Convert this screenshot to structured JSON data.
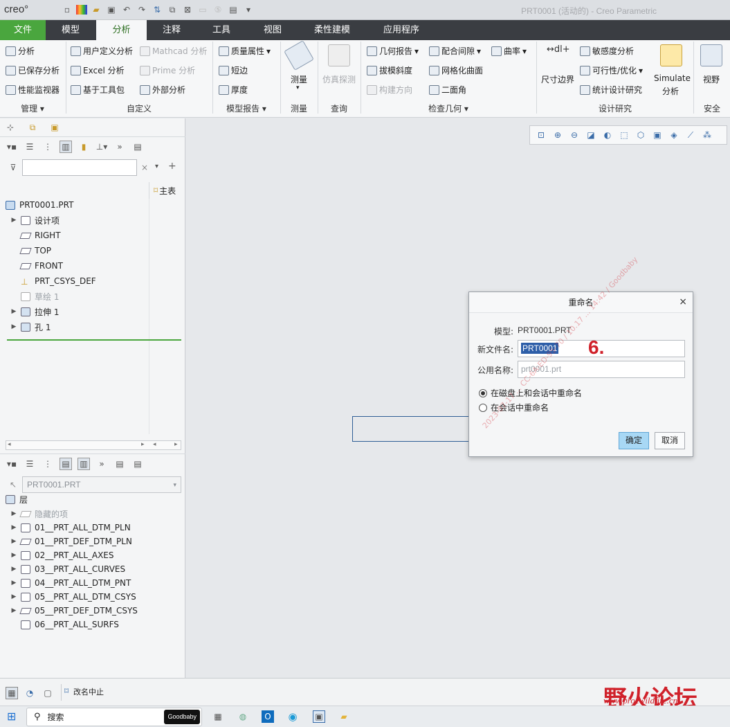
{
  "window": {
    "logo": "creo°",
    "title": "PRT0001 (活动的) - Creo Parametric"
  },
  "tabs": [
    "文件",
    "模型",
    "分析",
    "注释",
    "工具",
    "视图",
    "柔性建模",
    "应用程序"
  ],
  "ribbon": {
    "manage": {
      "items": [
        "分析",
        "已保存分析",
        "性能监视器"
      ],
      "group": "管理"
    },
    "custom": {
      "items": [
        "用户定义分析",
        "Excel 分析",
        "基于工具包",
        "Mathcad 分析",
        "Prime 分析",
        "外部分析"
      ],
      "group": "自定义"
    },
    "model_report": {
      "items": [
        "质量属性",
        "短边",
        "厚度"
      ],
      "group": "模型报告"
    },
    "measure": {
      "label": "测量",
      "group": "测量"
    },
    "query": {
      "label": "仿真探测",
      "group": "查询"
    },
    "inspect": {
      "items": [
        "几何报告",
        "拔模斜度",
        "构建方向",
        "配合间隙",
        "网格化曲面",
        "二面角",
        "曲率"
      ],
      "group": "检查几何"
    },
    "design": {
      "items": [
        "尺寸边界",
        "敏感度分析",
        "可行性/优化",
        "统计设计研究",
        "Simulate",
        "分析"
      ],
      "group": "设计研究"
    },
    "security": {
      "label": "视野",
      "group": "安全"
    }
  },
  "model_tree": {
    "filter_placeholder": "",
    "column_header": "主表",
    "items": [
      {
        "label": "PRT0001.PRT"
      },
      {
        "label": "设计项"
      },
      {
        "label": "RIGHT"
      },
      {
        "label": "TOP"
      },
      {
        "label": "FRONT"
      },
      {
        "label": "PRT_CSYS_DEF"
      },
      {
        "label": "草绘 1"
      },
      {
        "label": "拉伸 1"
      },
      {
        "label": "孔 1"
      }
    ]
  },
  "layer_tree": {
    "model_select": "PRT0001.PRT",
    "root": "层",
    "items": [
      "隐藏的项",
      "01__PRT_ALL_DTM_PLN",
      "01__PRT_DEF_DTM_PLN",
      "02__PRT_ALL_AXES",
      "03__PRT_ALL_CURVES",
      "04__PRT_ALL_DTM_PNT",
      "05__PRT_ALL_DTM_CSYS",
      "05__PRT_DEF_DTM_CSYS",
      "06__PRT_ALL_SURFS"
    ]
  },
  "dialog": {
    "title": "重命名",
    "model_label": "模型:",
    "model_value": "PRT0001.PRT",
    "new_name_label": "新文件名:",
    "new_name_value": "PRT0001",
    "common_name_label": "公用名称:",
    "common_name_value": "prt0001.prt",
    "option_disk": "在磁盘上和会话中重命名",
    "option_session": "在会话中重命名",
    "ok": "确定",
    "cancel": "取消",
    "step_marker": "6.",
    "watermark": "2023-07-17 ... CC-6A-ED-95-70 / 10.17 ... 14:42 / Goodbaby"
  },
  "status": {
    "message": "改名中止"
  },
  "taskbar": {
    "search": "搜索",
    "app_tag": "Goodbaby"
  },
  "forum": {
    "name": "野火论坛",
    "url": "www.proewildfire.cn"
  }
}
